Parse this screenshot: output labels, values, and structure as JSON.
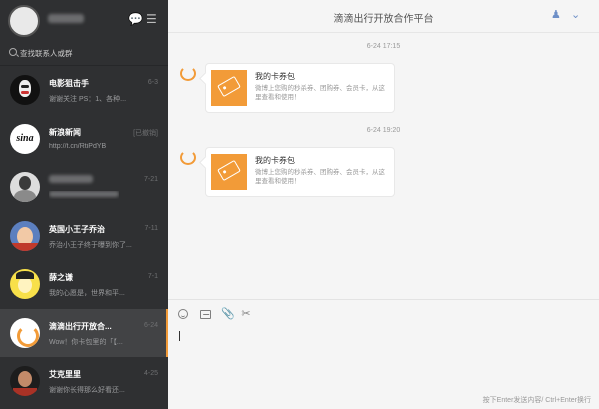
{
  "app": {
    "header_title": "滴滴出行开放合作平台"
  },
  "search": {
    "placeholder": "查找联系人或群"
  },
  "contacts": [
    {
      "name": "电影狙击手",
      "preview": "谢谢关注 PS：1、各种...",
      "time": "6-3",
      "avatar": "jigsaw"
    },
    {
      "name": "新浪新闻",
      "preview": "http://t.cn/RtiPdYB",
      "time": "[已撤销]",
      "avatar": "sina"
    },
    {
      "name": "",
      "preview": "",
      "time": "7-21",
      "avatar": "person"
    },
    {
      "name": "英国小王子乔治",
      "preview": "乔治小王子终于曝到你了...",
      "time": "7-11",
      "avatar": "prince"
    },
    {
      "name": "薛之谦",
      "preview": "我的心愿是，世界和平...",
      "time": "7-1",
      "avatar": "yellow"
    },
    {
      "name": "滴滴出行开放合...",
      "preview": "Wow！你卡包里的「【...",
      "time": "6-24",
      "avatar": "didi"
    },
    {
      "name": "艾克里里",
      "preview": "谢谢你长得那么好看还...",
      "time": "4-25",
      "avatar": "dark"
    }
  ],
  "messages": [
    {
      "timestamp": "6-24 17:15",
      "card_title": "我的卡券包",
      "card_desc": "微博上您购的秒杀券、团购券、会员卡，从这里查看和使用！"
    },
    {
      "timestamp": "6-24 19:20",
      "card_title": "我的卡券包",
      "card_desc": "微博上您购的秒杀券、团购券、会员卡，从这里查看和使用！"
    }
  ],
  "composer": {
    "send_hint": "按下Enter发送内容/ Ctrl+Enter换行"
  },
  "icons": {
    "chat": "chat-bubble-icon",
    "menu": "menu-list-icon",
    "add_user": "add-user-icon",
    "chevron": "chevron-down-icon"
  },
  "colors": {
    "accent": "#f29b38",
    "sidebar": "#2f3032"
  }
}
